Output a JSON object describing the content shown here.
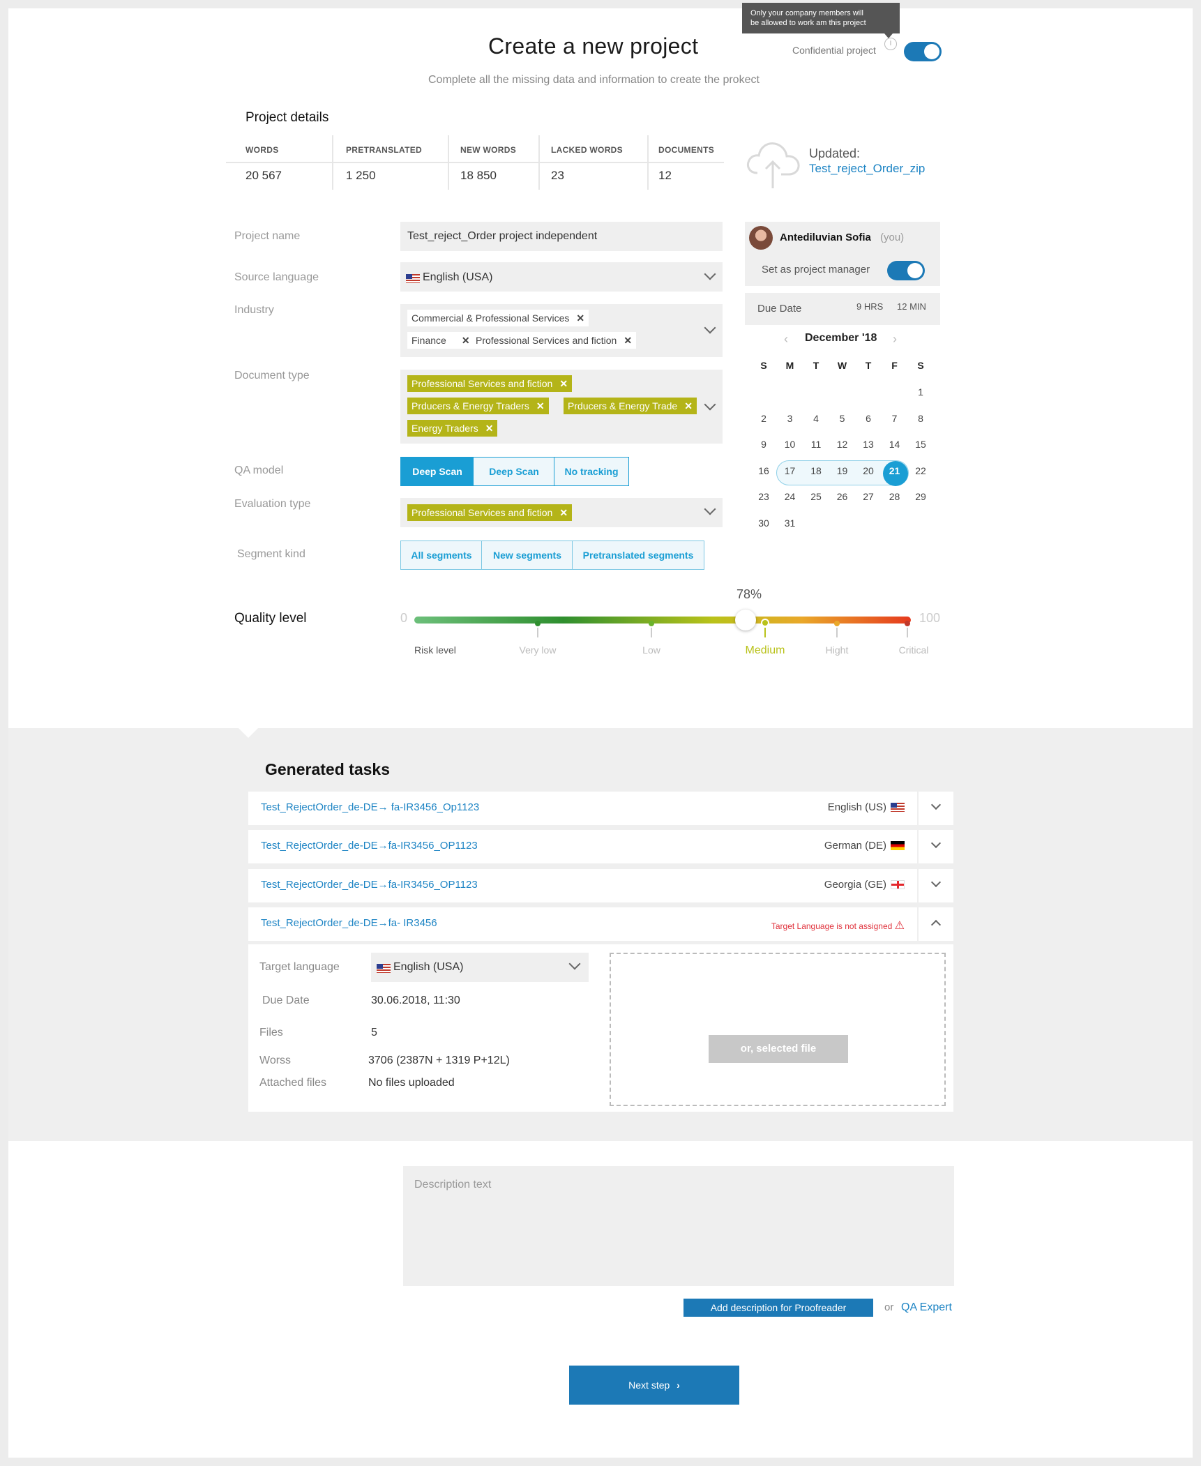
{
  "header": {
    "title": "Create a new project",
    "subtitle": "Complete all the missing data and information to create the prokect",
    "tooltip_line1": "Only your company members will",
    "tooltip_line2": "be allowed to work am this project",
    "confidential_label": "Confidential project",
    "confidential_on": true
  },
  "details": {
    "heading": "Project details",
    "stats": [
      {
        "label": "WORDS",
        "value": "20 567"
      },
      {
        "label": "PRETRANSLATED",
        "value": "1 250"
      },
      {
        "label": "NEW WORDS",
        "value": "18 850"
      },
      {
        "label": "LACKED WORDS",
        "value": "23"
      },
      {
        "label": "DOCUMENTS",
        "value": "12"
      }
    ],
    "updated_label": "Updated:",
    "updated_file": "Test_reject_Order_zip"
  },
  "form": {
    "project_name_label": "Project name",
    "project_name_value": "Test_reject_Order project independent",
    "source_language_label": "Source language",
    "source_language_value": "English (USA)",
    "industry_label": "Industry",
    "industry_chips": [
      "Commercial & Professional Services",
      "Finance",
      "Professional Services and fiction"
    ],
    "document_type_label": "Document type",
    "document_type_chips": [
      "Professional Services and fiction",
      "Prducers & Energy Traders",
      "Prducers & Energy Trade",
      "Energy Traders"
    ],
    "qa_model_label": "QA model",
    "qa_model_options": [
      "Deep Scan",
      "Deep Scan",
      "No tracking"
    ],
    "evaluation_type_label": "Evaluation type",
    "evaluation_type_chip": "Professional Services and fiction",
    "segment_kind_label": "Segment kind",
    "segment_kind_options": [
      "All segments",
      "New segments",
      "Pretranslated segments"
    ]
  },
  "manager": {
    "name": "Antediluvian Sofia",
    "you": "(you)",
    "set_manager_label": "Set as project manager",
    "set_manager_on": true,
    "due_date_label": "Due Date",
    "hrs": "9 HRS",
    "min": "12 MIN",
    "month": "December '18",
    "weekdays": [
      "S",
      "M",
      "T",
      "W",
      "T",
      "F",
      "S"
    ],
    "selected_range": [
      17,
      21
    ],
    "selected_day": 21
  },
  "quality": {
    "label": "Quality level",
    "min": "0",
    "max": "100",
    "value_text": "78%",
    "value": 78,
    "risk_label": "Risk level",
    "levels": [
      "Very low",
      "Low",
      "Medium",
      "Hight",
      "Critical"
    ],
    "active_level": "Medium"
  },
  "tasks": {
    "heading": "Generated tasks",
    "items": [
      {
        "name": "Test_RejectOrder_de-DE→ fa-IR3456_Op1123",
        "lang": "English (US)",
        "flag": "us"
      },
      {
        "name": "Test_RejectOrder_de-DE→fa-IR3456_OP1123",
        "lang": "German (DE)",
        "flag": "de"
      },
      {
        "name": "Test_RejectOrder_de-DE→fa-IR3456_OP1123",
        "lang": "Georgia (GE)",
        "flag": "ge"
      },
      {
        "name": "Test_RejectOrder_de-DE→fa- IR3456",
        "warning": "Target Language is not assigned"
      }
    ],
    "expanded": {
      "target_language_label": "Target language",
      "target_language_value": "English (USA)",
      "due_date_label": "Due Date",
      "due_date_value": "30.06.2018, 11:30",
      "files_label": "Files",
      "files_value": "5",
      "words_label": "Worss",
      "words_value": "3706 (2387N + 1319 P+12L)",
      "attached_label": "Attached files",
      "attached_value": "No files uploaded",
      "dropzone_button": "or, selected file"
    }
  },
  "description": {
    "placeholder": "Description text",
    "add_button": "Add description for Proofreader",
    "or": "or",
    "qa_link": "QA Expert"
  },
  "footer": {
    "next_button": "Next step"
  },
  "colors": {
    "accent": "#1a9ed4",
    "dark_blue": "#1c79b6",
    "olive": "#b4b418",
    "warning": "#e0323c"
  }
}
